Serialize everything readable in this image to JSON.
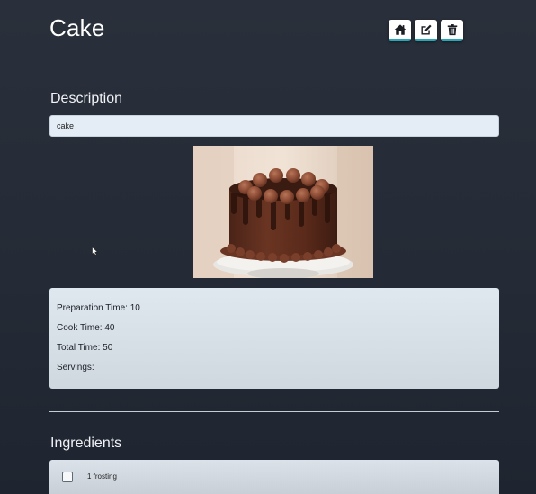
{
  "page": {
    "title": "Cake"
  },
  "toolbar": {
    "buttons": [
      {
        "icon": "home-icon",
        "action": "home"
      },
      {
        "icon": "edit-icon",
        "action": "edit"
      },
      {
        "icon": "trash-icon",
        "action": "delete"
      }
    ]
  },
  "description": {
    "heading": "Description",
    "value": "cake"
  },
  "image": {
    "subject": "chocolate drip cake"
  },
  "details": {
    "prep": "Preparation Time: 10",
    "cook": "Cook Time: 40",
    "total": "Total Time: 50",
    "servings": "Servings:"
  },
  "ingredients": {
    "heading": "Ingredients",
    "items": [
      {
        "label": "1 frosting",
        "checked": false
      }
    ]
  },
  "colors": {
    "background": "#272d38",
    "button_accent": "#2aa7b6",
    "card": "#d8e0e8"
  }
}
